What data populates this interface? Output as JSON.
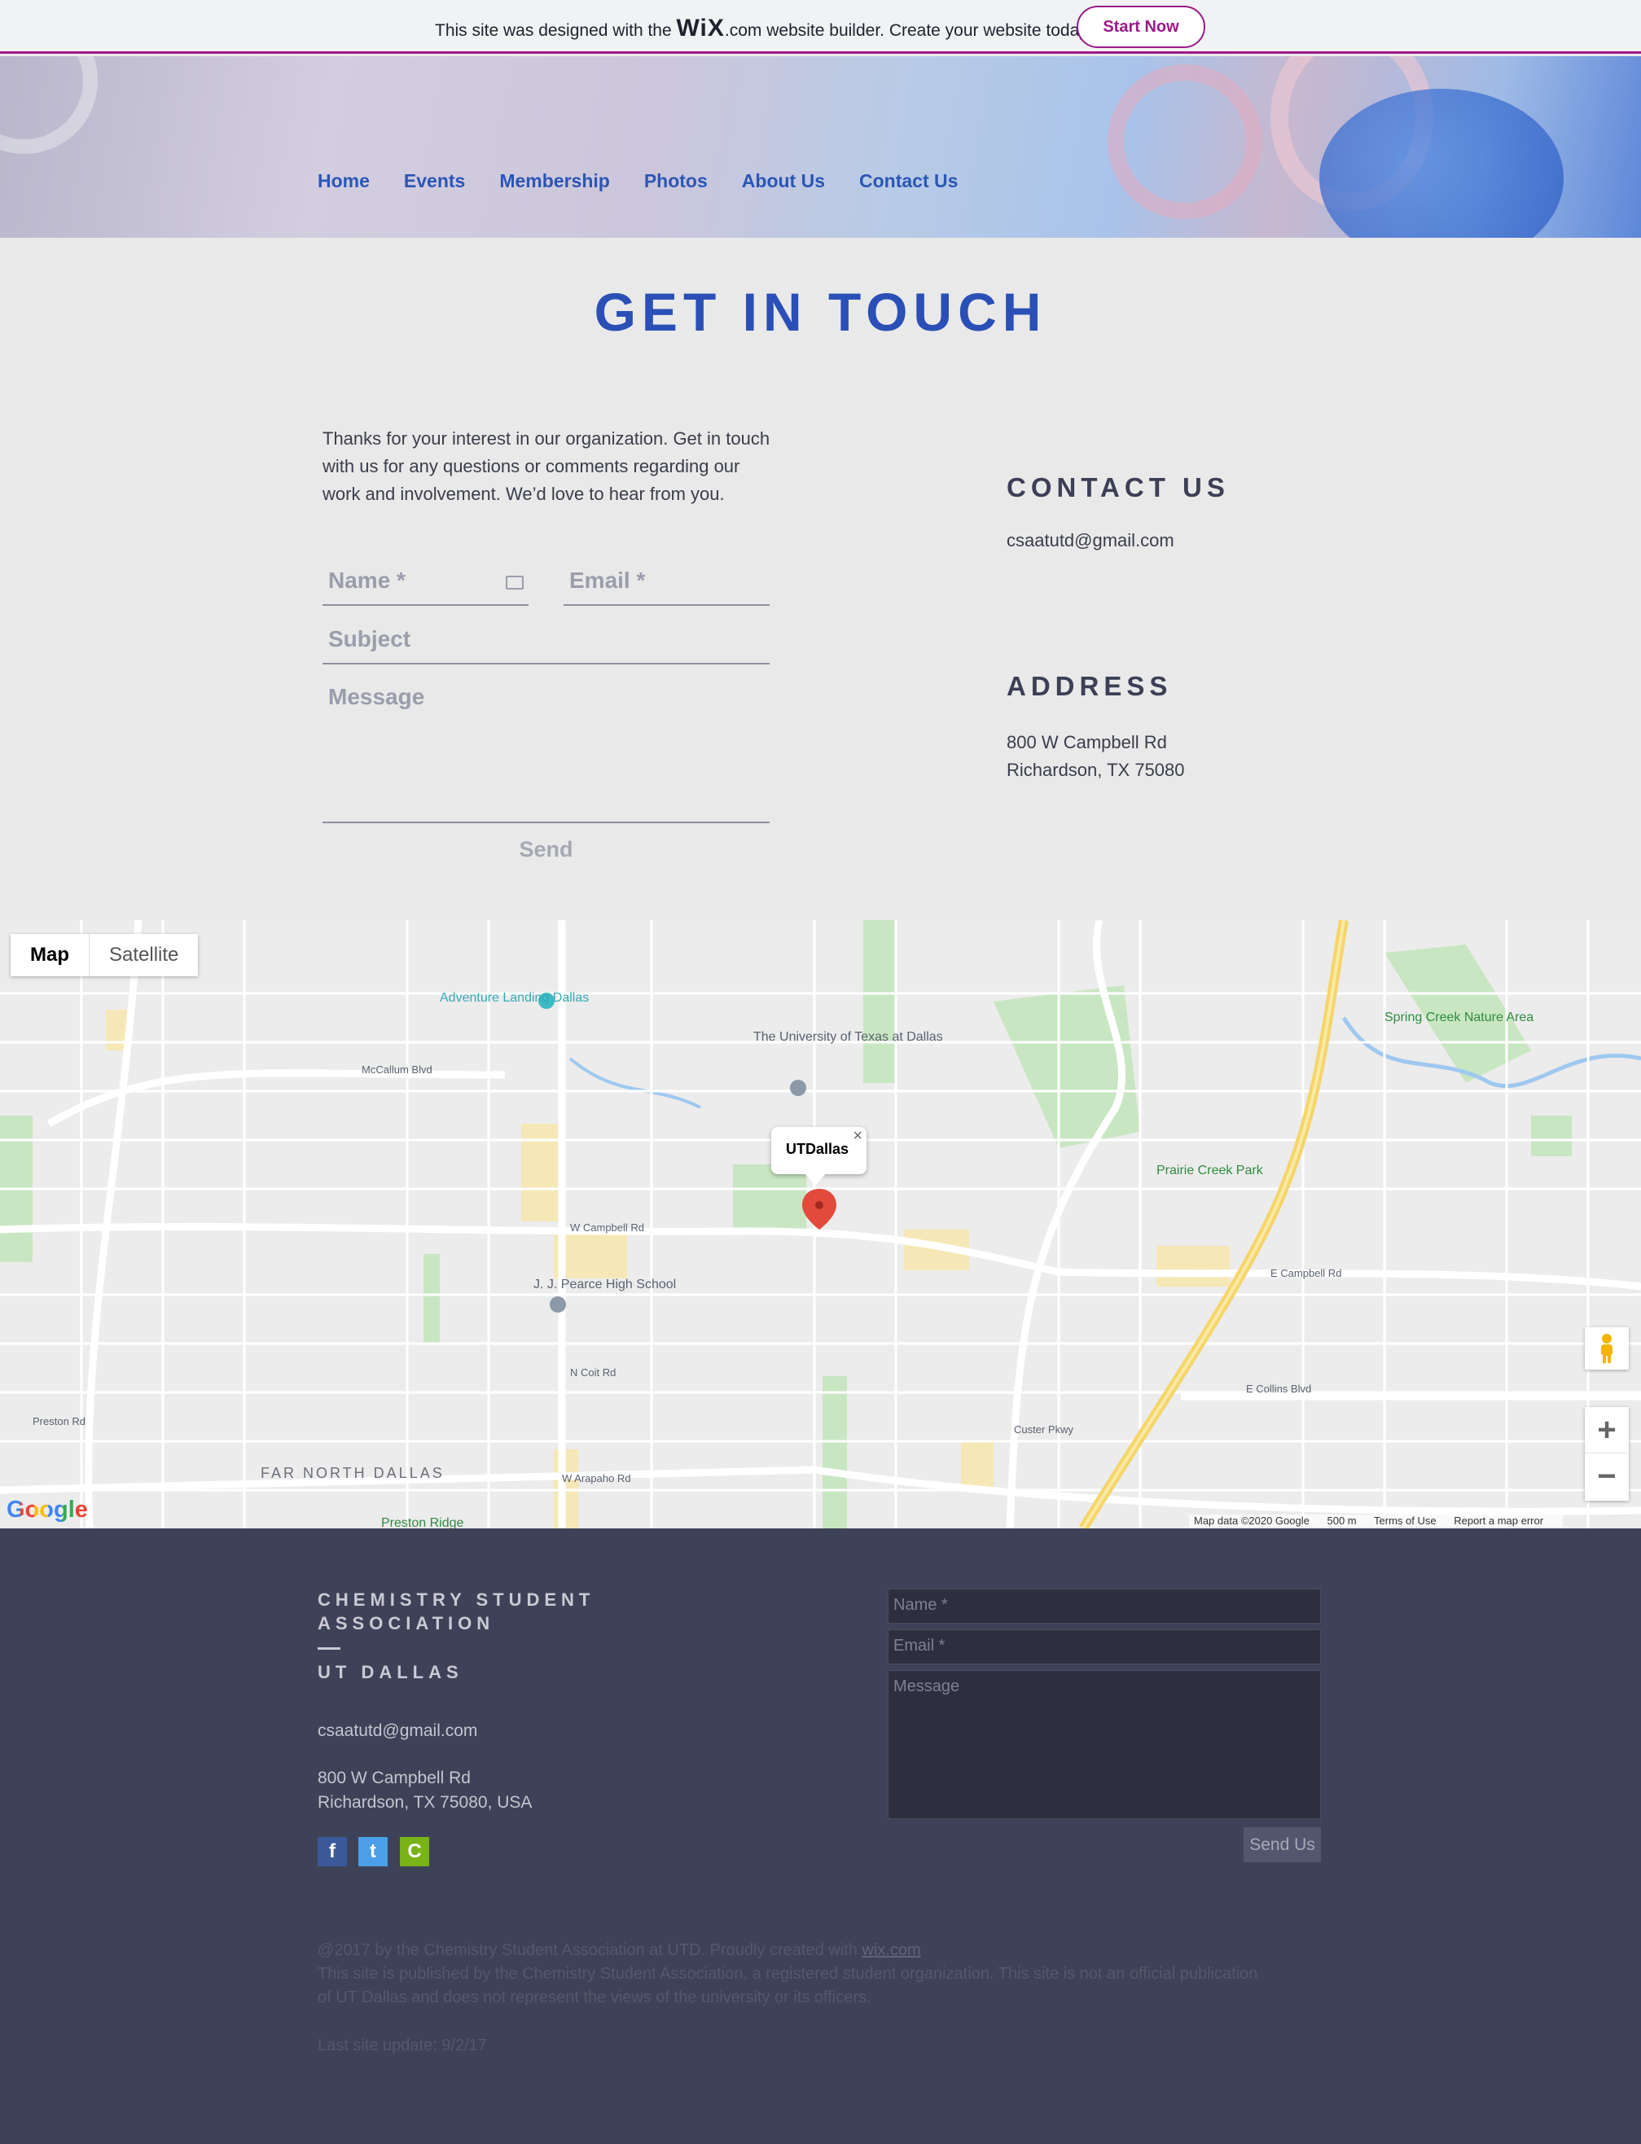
{
  "wix_banner": {
    "text_before": "This site was designed with the ",
    "logo": "WiX",
    "text_after": ".com website builder. Create your website today.",
    "button": "Start Now",
    "accent_color": "#9b1a8a"
  },
  "nav": {
    "items": [
      "Home",
      "Events",
      "Membership",
      "Photos",
      "About Us",
      "Contact Us"
    ],
    "color": "#2a56b5"
  },
  "contact": {
    "title": "GET IN TOUCH",
    "intro": "Thanks for your interest in our organization. Get in touch with us for any questions or comments regarding our work and involvement. We’d love to hear from you.",
    "form": {
      "name_placeholder": "Name *",
      "email_placeholder": "Email *",
      "subject_placeholder": "Subject",
      "message_placeholder": "Message",
      "send_label": "Send"
    },
    "contact_heading": "CONTACT US",
    "email": "csaatutd@gmail.com",
    "address_heading": "ADDRESS",
    "address_line1": "800 W Campbell Rd",
    "address_line2": "Richardson, TX 75080"
  },
  "map": {
    "type_map": "Map",
    "type_satellite": "Satellite",
    "marker_label": "UTDallas",
    "close_glyph": "×",
    "zoom_in": "+",
    "zoom_out": "−",
    "labels": {
      "utd": "The University of Texas at Dallas",
      "adventure": "Adventure Landing Dallas",
      "pearce": "J. J. Pearce High School",
      "spring_creek": "Spring Creek Nature Area",
      "prairie": "Prairie Creek Park",
      "far_north": "FAR NORTH DALLAS",
      "mccallum": "McCallum Blvd",
      "campbell": "W Campbell Rd",
      "e_campbell": "E Campbell Rd",
      "arapaho": "W Arapaho Rd",
      "collins": "E Collins Blvd",
      "coit": "N Coit Rd",
      "custer": "Custer Pkwy",
      "preston": "Preston Rd",
      "preston_ridge": "Preston Ridge"
    },
    "google": "Google",
    "attribution": "Map data ©2020 Google",
    "scale": "500 m",
    "terms": "Terms of Use",
    "report": "Report a map error"
  },
  "footer": {
    "org_line1": "CHEMISTRY STUDENT",
    "org_line2": "ASSOCIATION",
    "org_line3": "UT DALLAS",
    "email": "csaatutd@gmail.com",
    "address_line1": "800 W Campbell Rd",
    "address_line2": "Richardson, TX 75080, USA",
    "social": [
      {
        "icon": "facebook-icon",
        "glyph": "f",
        "color": "#3b5998"
      },
      {
        "icon": "twitter-icon",
        "glyph": "t",
        "color": "#4a9fe8"
      },
      {
        "icon": "ratemyprofessor-icon",
        "glyph": "C",
        "color": "#7ab317"
      }
    ],
    "form": {
      "name_placeholder": "Name *",
      "email_placeholder": "Email *",
      "message_placeholder": "Message",
      "send_label": "Send Us"
    },
    "legal_line1_prefix": "@2017 by the Chemistry Student Association at UTD. Proudly created with ",
    "legal_link": "wix.com",
    "legal_line2": "This site is published by the Chemistry Student Association, a registered student organization. This site is not an official publication",
    "legal_line3": "of UT Dallas and does not represent the views of the university or its officers.",
    "last_update": "Last site update: 9/2/17"
  }
}
